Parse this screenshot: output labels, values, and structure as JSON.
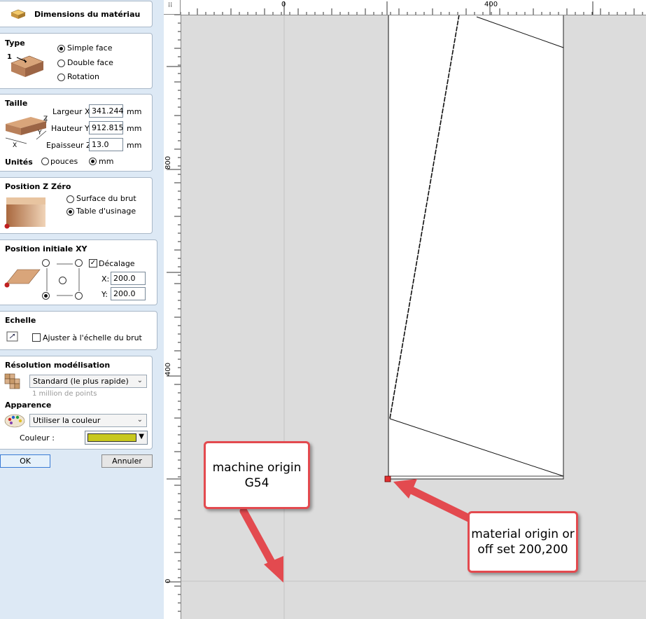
{
  "header": {
    "title": "Dimensions du matériau"
  },
  "type_section": {
    "title": "Type",
    "icon_number": "1",
    "options": [
      "Simple face",
      "Double face",
      "Rotation"
    ],
    "selected": "Simple face"
  },
  "size_section": {
    "title": "Taille",
    "axis_labels": {
      "z": "Z",
      "y": "Y",
      "x": "X"
    },
    "fields": [
      {
        "label": "Largeur X:",
        "value": "341.244",
        "unit": "mm"
      },
      {
        "label": "Hauteur Y:",
        "value": "912.815",
        "unit": "mm"
      },
      {
        "label": "Epaisseur Z:",
        "value": "13.0",
        "unit": "mm"
      }
    ],
    "units_label": "Unités",
    "unit_options": [
      "pouces",
      "mm"
    ],
    "unit_selected": "mm"
  },
  "zzero_section": {
    "title": "Position Z Zéro",
    "options": [
      "Surface du brut",
      "Table d'usinage"
    ],
    "selected": "Table d'usinage"
  },
  "xy_section": {
    "title": "Position initiale XY",
    "offset_label": "Décalage",
    "offset_checked": true,
    "x_label": "X:",
    "x_value": "200.0",
    "y_label": "Y:",
    "y_value": "200.0"
  },
  "scale_section": {
    "title": "Echelle",
    "checkbox_label": "Ajuster à l'échelle du brut",
    "checked": false
  },
  "resolution_section": {
    "title": "Résolution modélisation",
    "select_value": "Standard (le plus rapide)",
    "hint": "1 million de points",
    "appearance_title": "Apparence",
    "appearance_value": "Utiliser la couleur",
    "color_label": "Couleur :",
    "color_value": "#c8c81e"
  },
  "buttons": {
    "ok": "OK",
    "cancel": "Annuler"
  },
  "rulers": {
    "top_labels": [
      "0",
      "400"
    ],
    "left_labels": [
      "800",
      "400",
      "0"
    ]
  },
  "annotations": {
    "machine_origin": "machine origin\nG54",
    "material_origin": "material origin or\noff set 200,200"
  },
  "colors": {
    "panel_bg": "#dde9f5",
    "callout_border": "#e34a4f",
    "origin_marker": "#e03030"
  }
}
